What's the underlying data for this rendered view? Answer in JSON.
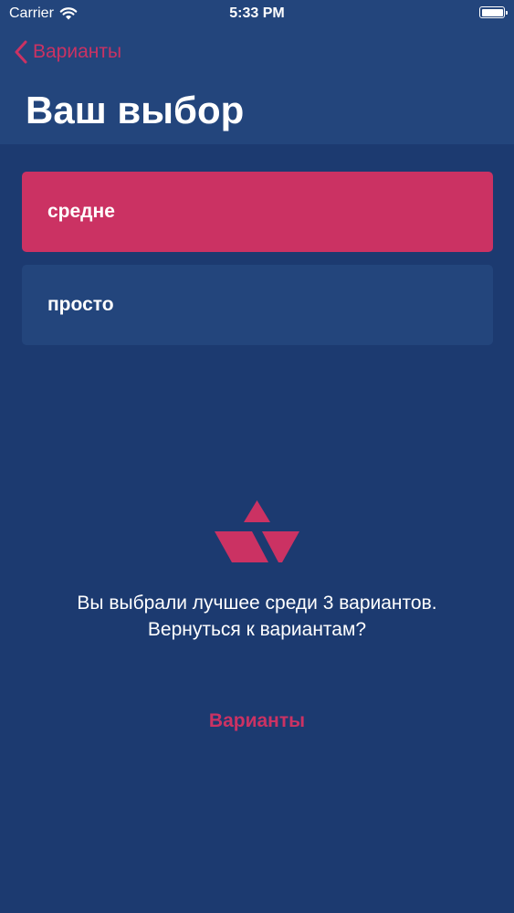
{
  "status_bar": {
    "carrier": "Carrier",
    "time": "5:33 PM"
  },
  "nav": {
    "back_label": "Варианты",
    "title": "Ваш выбор"
  },
  "options": [
    {
      "label": "средне",
      "selected": true
    },
    {
      "label": "просто",
      "selected": false
    }
  ],
  "result": {
    "message": "Вы выбрали лучшее среди 3 вариантов. Вернуться к вариантам?",
    "action_label": "Варианты"
  },
  "colors": {
    "background": "#1c3a70",
    "header": "#23457c",
    "accent": "#cb3263",
    "text": "#ffffff"
  },
  "icons": {
    "back": "chevron-left-icon",
    "wifi": "wifi-icon",
    "battery": "battery-icon",
    "logo": "logo-icon"
  }
}
